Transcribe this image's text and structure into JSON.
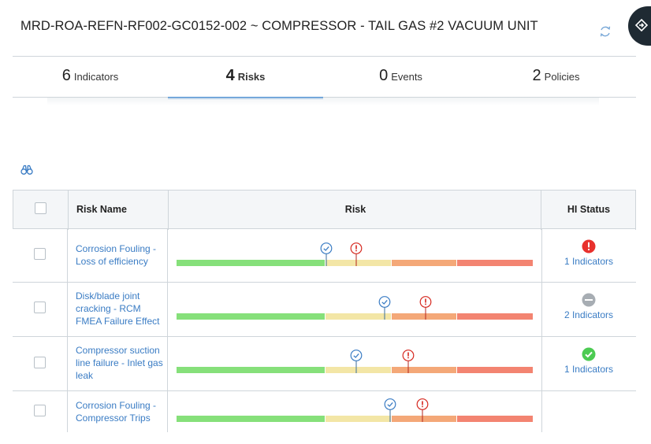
{
  "asset": {
    "title": "MRD-ROA-REFN-RF002-GC0152-002 ~ COMPRESSOR - TAIL GAS #2 VACUUM UNIT"
  },
  "icons": {
    "refresh": "refresh-icon",
    "side_panel": "side-panel-toggle-icon",
    "find": "binoculars-icon"
  },
  "tabs": [
    {
      "count": "6",
      "label": "Indicators",
      "active": false
    },
    {
      "count": "4",
      "label": "Risks",
      "active": true
    },
    {
      "count": "0",
      "label": "Events",
      "active": false
    },
    {
      "count": "2",
      "label": "Policies",
      "active": false
    }
  ],
  "grid": {
    "columns": {
      "risk_name": "Risk Name",
      "risk": "Risk",
      "hi_status": "HI Status"
    },
    "rows": [
      {
        "name": "Corrosion Fouling - Loss of efficiency",
        "mitigated_fraction": 0.42,
        "unmitigated_fraction": 0.505,
        "hi_status": "alert",
        "hi_label": "1 Indicators"
      },
      {
        "name": "Disk/blade joint cracking - RCM FMEA Failure Effect",
        "mitigated_fraction": 0.585,
        "unmitigated_fraction": 0.7,
        "hi_status": "none",
        "hi_label": "2 Indicators"
      },
      {
        "name": "Compressor suction line failure - Inlet gas leak",
        "mitigated_fraction": 0.505,
        "unmitigated_fraction": 0.65,
        "hi_status": "ok",
        "hi_label": "1 Indicators"
      },
      {
        "name": "Corrosion Fouling - Compressor Trips",
        "mitigated_fraction": 0.6,
        "unmitigated_fraction": 0.69,
        "hi_status": "",
        "hi_label": ""
      }
    ]
  },
  "colors": {
    "accent": "#3c86cf",
    "link": "#3a7cc4",
    "risk_low": "#86e07a",
    "risk_medium": "#f3e6a6",
    "risk_high": "#f4a878",
    "risk_extreme": "#f38471",
    "alert": "#e8312d",
    "ok": "#4ccb52",
    "neutral": "#a7adb3"
  }
}
